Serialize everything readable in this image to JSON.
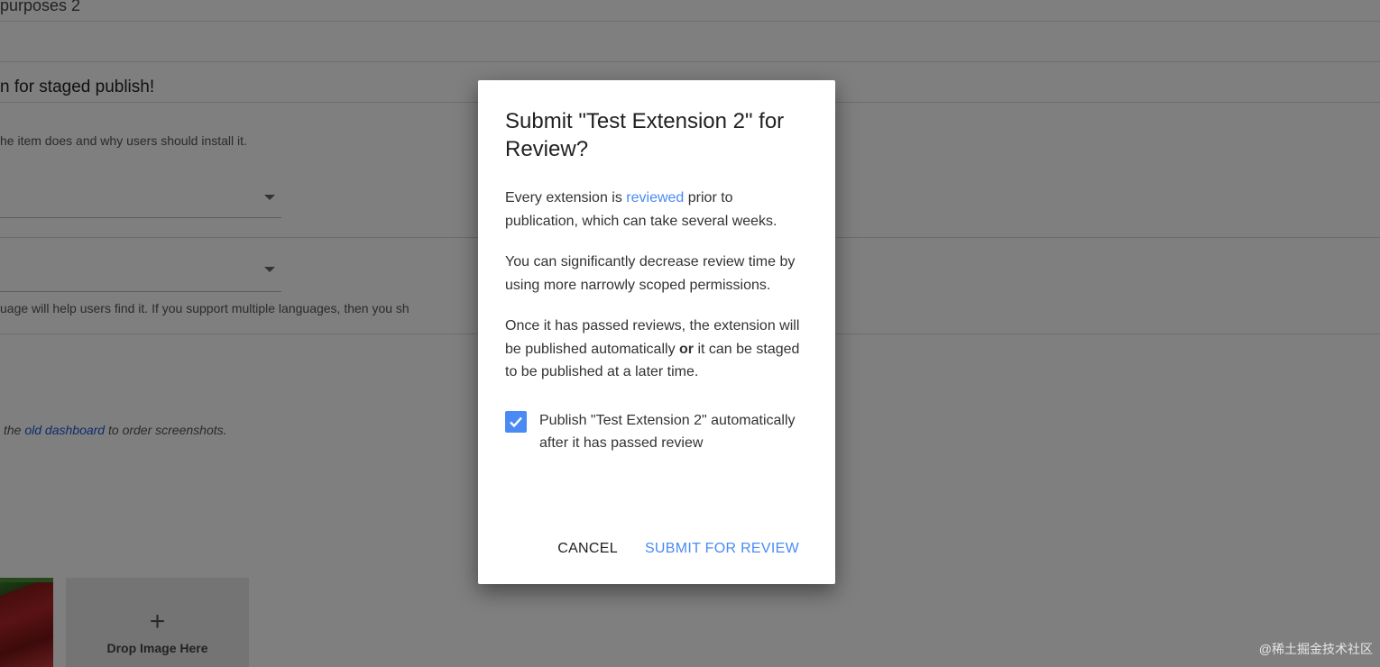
{
  "background": {
    "section_title": "purposes 2",
    "staged_heading": "n for staged publish!",
    "description_hint": "he item does and why users should install it.",
    "language_hint": "uage will help users find it. If you support multiple languages, then you sh",
    "screenshots_hint_prefix": "the",
    "screenshots_hint_link": "old dashboard",
    "screenshots_hint_suffix": "to order screenshots.",
    "drop_plus": "+",
    "drop_label": "Drop Image Here"
  },
  "dialog": {
    "title": "Submit \"Test Extension 2\" for Review?",
    "p1_before": "Every extension is ",
    "p1_link": "reviewed",
    "p1_after": " prior to publication, which can take several weeks.",
    "p2": "You can significantly decrease review time by using more narrowly scoped permissions.",
    "p3_before": "Once it has passed reviews, the extension will be published automatically ",
    "p3_bold": "or",
    "p3_after": " it can be staged to be published at a later time.",
    "checkbox_label": "Publish \"Test Extension 2\" automatically after it has passed review",
    "checkbox_checked": true,
    "cancel_label": "CANCEL",
    "submit_label": "SUBMIT FOR REVIEW"
  },
  "colors": {
    "accent": "#4a8af4",
    "link": "#1a57d9",
    "overlay": "rgba(0,0,0,0.50)"
  },
  "watermark": "@稀土掘金技术社区"
}
